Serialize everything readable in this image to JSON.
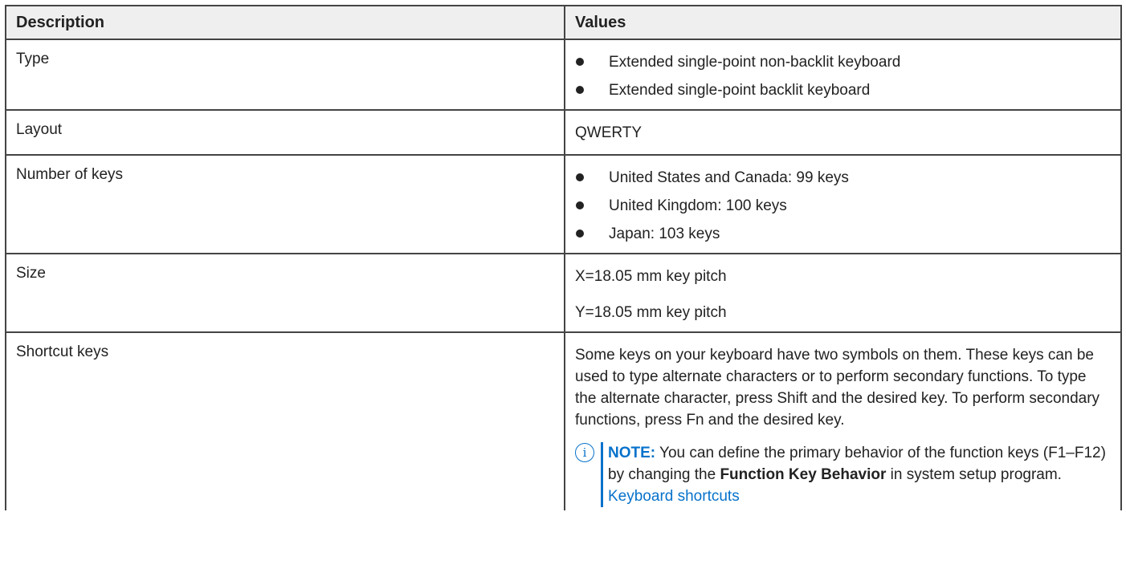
{
  "table": {
    "headers": [
      "Description",
      "Values"
    ],
    "rows": {
      "type": {
        "label": "Type",
        "values": [
          "Extended single-point non-backlit keyboard",
          "Extended single-point backlit keyboard"
        ]
      },
      "layout": {
        "label": "Layout",
        "value": "QWERTY"
      },
      "keys": {
        "label": "Number of keys",
        "values": [
          "United States and Canada: 99 keys",
          "United Kingdom: 100 keys",
          "Japan: 103 keys"
        ]
      },
      "size": {
        "label": "Size",
        "values": [
          "X=18.05 mm key pitch",
          "Y=18.05 mm key pitch"
        ]
      },
      "shortcut": {
        "label": "Shortcut keys",
        "text": "Some keys on your keyboard have two symbols on them. These keys can be used to type alternate characters or to perform secondary functions. To type the alternate character, press Shift and the desired key. To perform secondary functions, press Fn and the desired key.",
        "note": {
          "icon": "info-circle-icon",
          "label": "NOTE:",
          "text_before": " You can define the primary behavior of the function keys (F1–F12) by changing the ",
          "bold": "Function Key Behavior",
          "text_after": " in system setup program. ",
          "link": "Keyboard shortcuts"
        }
      }
    }
  },
  "colors": {
    "accent": "#0672cb",
    "header_bg": "#efefef",
    "border": "#444444",
    "text": "#222222"
  }
}
